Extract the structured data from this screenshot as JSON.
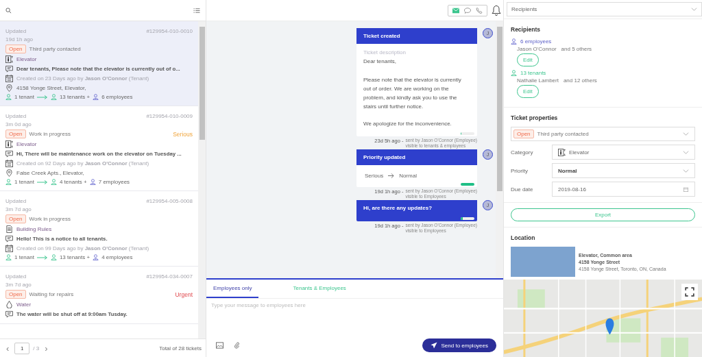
{
  "tickets": [
    {
      "selected": true,
      "updated": "Updated",
      "age": "19d 1h ago",
      "number": "#129954-010-0010",
      "status": "Open",
      "stage": "Third party contacted",
      "category": {
        "kind": "elevator",
        "label": "Elevator"
      },
      "message": "Dear tenants, Please note that the elevator is currently out of o...",
      "created": "Created on 23 Days ago by **Jason O'Connor** (Tenant)",
      "address": "4158 Yonge Street,   Elevator,",
      "audience": {
        "from": "1 tenant",
        "tenants": "13 tenants +",
        "employees": "6 employees"
      }
    },
    {
      "selected": false,
      "updated": "Updated",
      "age": "3m 0d ago",
      "number": "#129954-010-0009",
      "status": "Open",
      "stage": "Work in progress",
      "priority": {
        "label": "Serious",
        "kind": "serious"
      },
      "category": {
        "kind": "elevator",
        "label": "Elevator"
      },
      "message": "Hi, There will be maintenance work on the elevator on Tuesday ...",
      "created": "Created on 92 Days ago by **Jason O'Connor** (Tenant)",
      "address": "False Creek Apts.,   Elevator,",
      "audience": {
        "from": "1 tenant",
        "tenants": "4 tenants +",
        "employees": "7 employees"
      }
    },
    {
      "selected": false,
      "updated": "Updated",
      "age": "3m 7d ago",
      "number": "#129954-005-0008",
      "status": "Open",
      "stage": "Work in progress",
      "category": {
        "kind": "document",
        "label": "Building Rules"
      },
      "message": "Hello! This is a notice to all tenants.",
      "created": "Created on 99 Days ago by **Jason O'Connor** (Tenant)",
      "audience": {
        "from": "1 tenant",
        "tenants": "13 tenants +",
        "employees": "4 employees"
      }
    },
    {
      "selected": false,
      "updated": "Updated",
      "age": "3m 7d ago",
      "number": "#129954-034-0007",
      "status": "Open",
      "stage": "Waiting for repairs",
      "priority": {
        "label": "Urgent",
        "kind": "urgent"
      },
      "category": {
        "kind": "water",
        "label": "Water"
      },
      "message": "The water will be shut off at 9:00am Tusday."
    }
  ],
  "pagination": {
    "prev": "‹",
    "next": "›",
    "page": "1",
    "pages": "/ 3",
    "total": "Total of 28 tickets"
  },
  "channels": [
    {
      "kind": "email",
      "selected": true
    },
    {
      "kind": "chat",
      "selected": false
    },
    {
      "kind": "phone",
      "selected": false
    }
  ],
  "messages": [
    {
      "kind": "description",
      "title": "Ticket created",
      "label": "Ticket description",
      "paragraphs": [
        "Dear tenants,",
        "Please note that the elevator is currently out of order. We are working on the problem, and kindly ask you to use the stairs until further notice.",
        "We apologize for the inconvenience."
      ],
      "level": 0.04,
      "avatar": "J",
      "time": "23d 5h ago -",
      "sender": "sent by Jason O'Connor  (Employee)",
      "visibility": "visible to tenants & employees"
    },
    {
      "kind": "change",
      "title": "Priority updated",
      "from": "Serious",
      "to": "Normal",
      "level": 1,
      "avatar": "J",
      "time": "19d 1h ago -",
      "sender": "sent by Jason O'Connor  (Employee)",
      "visibility": "visible to Employees"
    },
    {
      "kind": "note",
      "title": "Hi, are there any updates?",
      "level": 0.15,
      "avatar": "J",
      "time": "19d 1h ago -",
      "sender": "sent by Jason O'Connor  (Employee)",
      "visibility": "visible to Employees"
    }
  ],
  "composer": {
    "tabs": [
      {
        "label": "Employees only",
        "selected": true
      },
      {
        "label": "Tenants & Employees",
        "selected": false
      }
    ],
    "placeholder": "Type your message to employees here",
    "send": "Send to employees"
  },
  "panel_select": "Recipients",
  "recipients": {
    "title": "Recipients",
    "groups": [
      {
        "kind": "employees",
        "count": "6 employees",
        "name": "Jason O'Connor",
        "others": "and 5 others",
        "button": "Edit"
      },
      {
        "kind": "tenants",
        "count": "13 tenants",
        "name": "Nathalie Lambert",
        "others": "and 12 others",
        "button": "Edit"
      }
    ]
  },
  "properties": {
    "title": "Ticket properties",
    "status": "Open",
    "stage": "Third party contacted",
    "fields": [
      {
        "kind": "category",
        "label": "Category",
        "value": "Elevator"
      },
      {
        "kind": "select",
        "label": "Priority",
        "value": "Normal"
      },
      {
        "kind": "date",
        "label": "Due date",
        "value": "2019-08-16"
      }
    ]
  },
  "export": "Export",
  "location": {
    "title": "Location",
    "name": "Elevator, Common area",
    "street": "4158 Yonge Street",
    "address": "4158 Yonge Street, Toronto, ON, Canada"
  }
}
